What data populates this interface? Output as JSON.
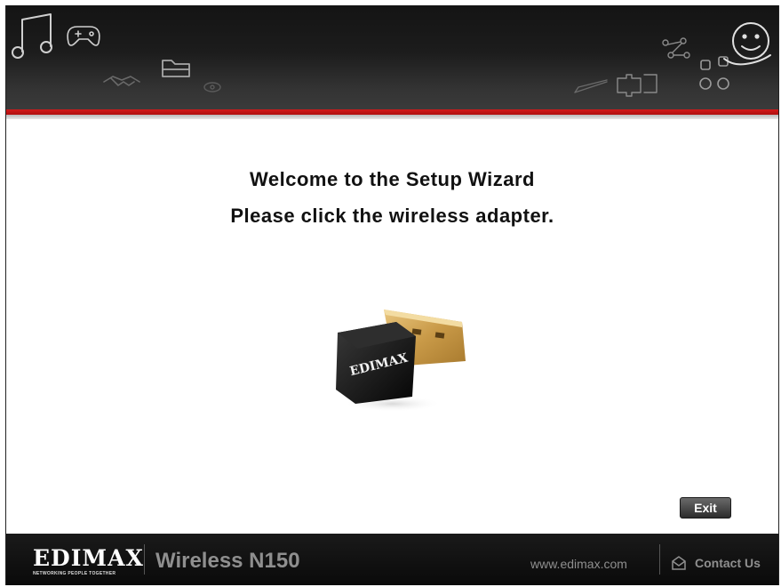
{
  "header": {
    "decorations": [
      "music-icon",
      "gamepad-icon",
      "handshake-icon",
      "folder-icon",
      "eye-icon",
      "pen-icon",
      "puzzle-icon",
      "molecule-icon",
      "smiley-icon",
      "network-icon"
    ]
  },
  "main": {
    "welcome_line1": "Welcome to the Setup Wizard",
    "welcome_line2": "Please click the wireless adapter.",
    "adapter_brand": "EDIMAX",
    "exit_label": "Exit"
  },
  "footer": {
    "brand": "EDIMAX",
    "tagline": "NETWORKING PEOPLE TOGETHER",
    "product": "Wireless N150",
    "website": "www.edimax.com",
    "contact_label": "Contact Us"
  },
  "colors": {
    "accent_red": "#c81414",
    "header_dark": "#1a1a1a",
    "footer_text": "#8f8f8f"
  }
}
